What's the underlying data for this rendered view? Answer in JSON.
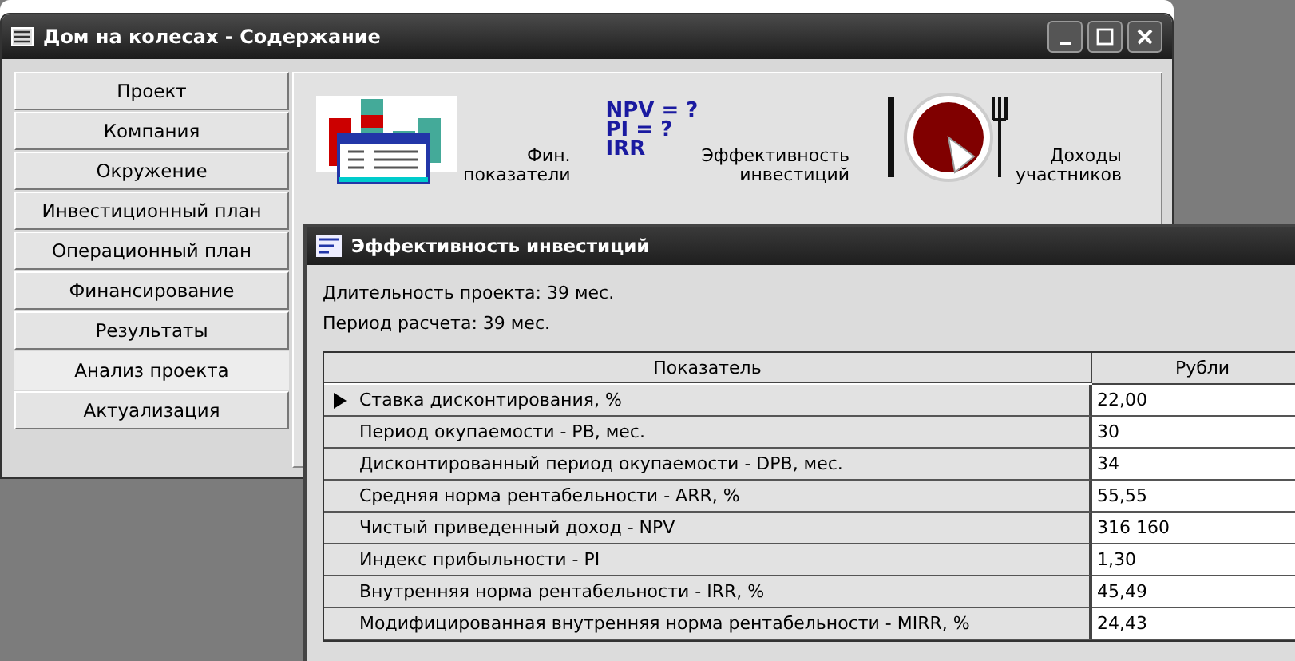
{
  "main_window": {
    "title": "Дом на колесах - Содержание"
  },
  "nav": [
    {
      "label": "Проект",
      "selected": false
    },
    {
      "label": "Компания",
      "selected": false
    },
    {
      "label": "Окружение",
      "selected": false
    },
    {
      "label": "Инвестиционный план",
      "selected": false
    },
    {
      "label": "Операционный план",
      "selected": false
    },
    {
      "label": "Финансирование",
      "selected": false
    },
    {
      "label": "Результаты",
      "selected": false
    },
    {
      "label": "Анализ проекта",
      "selected": true
    },
    {
      "label": "Актуализация",
      "selected": false
    }
  ],
  "toolbar": [
    {
      "kind": "chart",
      "lines": [
        "Фин.",
        "показатели"
      ]
    },
    {
      "kind": "formula",
      "formula": [
        "NPV = ?",
        "PI = ?",
        "IRR"
      ],
      "lines": [
        "Эффективность",
        "инвестиций"
      ]
    },
    {
      "kind": "pie",
      "lines": [
        "Доходы",
        "участников"
      ]
    }
  ],
  "dialog": {
    "title": "Эффективность инвестиций",
    "info": [
      "Длительность проекта: 39 мес.",
      "Период расчета: 39 мес."
    ],
    "table": {
      "columns": [
        "Показатель",
        "Рубли"
      ],
      "rows": [
        {
          "name": "Ставка дисконтирования, %",
          "value": "22,00",
          "current": true
        },
        {
          "name": "Период окупаемости - PB, мес.",
          "value": "30",
          "current": false
        },
        {
          "name": "Дисконтированный период окупаемости - DPB, мес.",
          "value": "34",
          "current": false
        },
        {
          "name": "Средняя норма рентабельности - ARR, %",
          "value": "55,55",
          "current": false
        },
        {
          "name": "Чистый приведенный доход - NPV",
          "value": "316 160",
          "current": false
        },
        {
          "name": "Индекс прибыльности - PI",
          "value": "1,30",
          "current": false
        },
        {
          "name": "Внутренняя норма рентабельности - IRR, %",
          "value": "45,49",
          "current": false
        },
        {
          "name": "Модифицированная внутренняя норма рентабельности - MIRR, %",
          "value": "24,43",
          "current": false
        }
      ]
    }
  }
}
